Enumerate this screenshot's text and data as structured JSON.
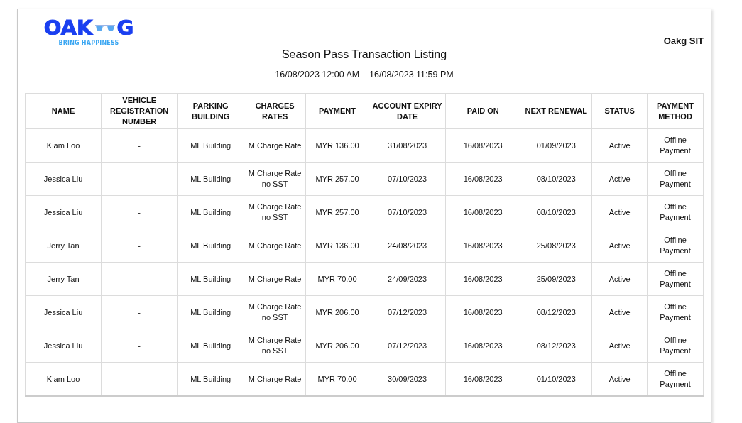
{
  "logo": {
    "letters_left": "OAK",
    "letters_right": "G",
    "tagline": "BRING HAPPINESS"
  },
  "company": "Oakg SIT",
  "title": "Season Pass Transaction Listing",
  "date_range": "16/08/2023 12:00 AM – 16/08/2023 11:59 PM",
  "table": {
    "columns": [
      "NAME",
      "VEHICLE REGISTRATION NUMBER",
      "PARKING BUILDING",
      "CHARGES RATES",
      "PAYMENT",
      "ACCOUNT EXPIRY DATE",
      "PAID ON",
      "NEXT RENEWAL",
      "STATUS",
      "PAYMENT METHOD"
    ],
    "rows": [
      [
        "Kiam Loo",
        "-",
        "ML Building",
        "M Charge Rate",
        "MYR 136.00",
        "31/08/2023",
        "16/08/2023",
        "01/09/2023",
        "Active",
        "Offline Payment"
      ],
      [
        "Jessica Liu",
        "-",
        "ML Building",
        "M Charge Rate no SST",
        "MYR 257.00",
        "07/10/2023",
        "16/08/2023",
        "08/10/2023",
        "Active",
        "Offline Payment"
      ],
      [
        "Jessica Liu",
        "-",
        "ML Building",
        "M Charge Rate no SST",
        "MYR 257.00",
        "07/10/2023",
        "16/08/2023",
        "08/10/2023",
        "Active",
        "Offline Payment"
      ],
      [
        "Jerry Tan",
        "-",
        "ML Building",
        "M Charge Rate",
        "MYR 136.00",
        "24/08/2023",
        "16/08/2023",
        "25/08/2023",
        "Active",
        "Offline Payment"
      ],
      [
        "Jerry Tan",
        "-",
        "ML Building",
        "M Charge Rate",
        "MYR 70.00",
        "24/09/2023",
        "16/08/2023",
        "25/09/2023",
        "Active",
        "Offline Payment"
      ],
      [
        "Jessica Liu",
        "-",
        "ML Building",
        "M Charge Rate no SST",
        "MYR 206.00",
        "07/12/2023",
        "16/08/2023",
        "08/12/2023",
        "Active",
        "Offline Payment"
      ],
      [
        "Jessica Liu",
        "-",
        "ML Building",
        "M Charge Rate no SST",
        "MYR 206.00",
        "07/12/2023",
        "16/08/2023",
        "08/12/2023",
        "Active",
        "Offline Payment"
      ],
      [
        "Kiam Loo",
        "-",
        "ML Building",
        "M Charge Rate",
        "MYR 70.00",
        "30/09/2023",
        "16/08/2023",
        "01/10/2023",
        "Active",
        "Offline Payment"
      ]
    ]
  }
}
